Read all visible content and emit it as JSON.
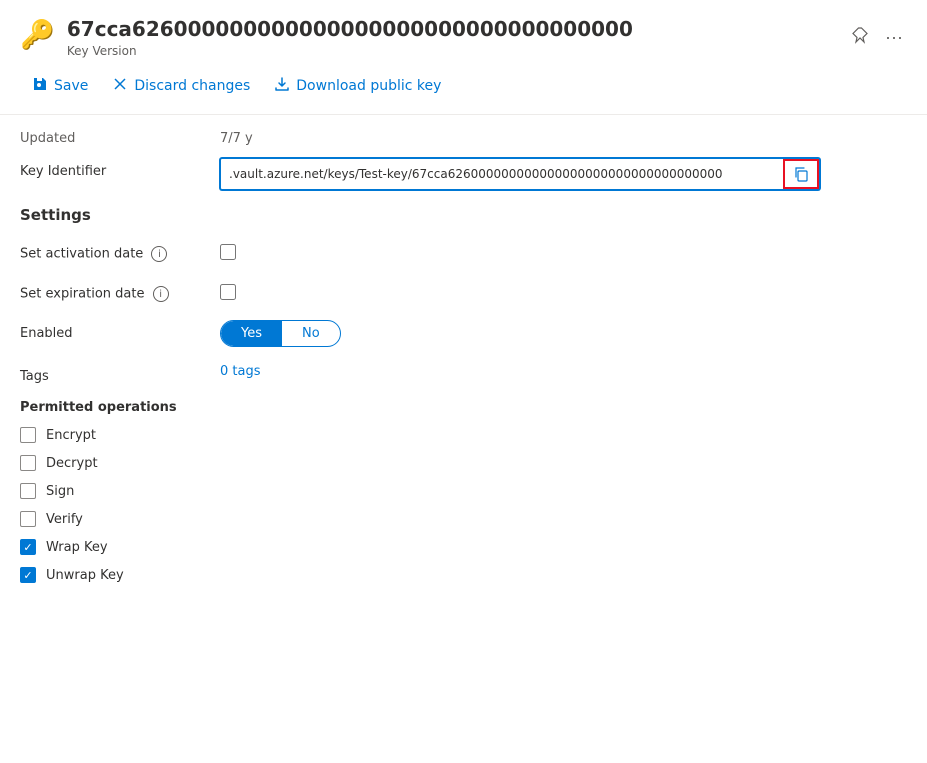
{
  "header": {
    "icon": "🔑",
    "title": "67cca626000000000000000000000000000000000",
    "subtitle": "Key Version",
    "pin_icon": "📌",
    "more_icon": "⋯"
  },
  "toolbar": {
    "save_label": "Save",
    "discard_label": "Discard changes",
    "download_label": "Download public key"
  },
  "updated_field": {
    "label": "Updated",
    "value": "7/7 y"
  },
  "key_identifier": {
    "label": "Key Identifier",
    "value": ".vault.azure.net/keys/Test-key/67cca626000000000000000000000000000000000",
    "copy_tooltip": "Copy to clipboard"
  },
  "settings": {
    "title": "Settings",
    "activation_date": {
      "label": "Set activation date",
      "checked": false
    },
    "expiration_date": {
      "label": "Set expiration date",
      "checked": false
    },
    "enabled": {
      "label": "Enabled",
      "yes_label": "Yes",
      "no_label": "No",
      "active": "yes"
    },
    "tags": {
      "label": "Tags",
      "value": "0 tags"
    }
  },
  "permitted_operations": {
    "title": "Permitted operations",
    "operations": [
      {
        "id": "encrypt",
        "label": "Encrypt",
        "checked": false
      },
      {
        "id": "decrypt",
        "label": "Decrypt",
        "checked": false
      },
      {
        "id": "sign",
        "label": "Sign",
        "checked": false
      },
      {
        "id": "verify",
        "label": "Verify",
        "checked": false
      },
      {
        "id": "wrap_key",
        "label": "Wrap Key",
        "checked": true
      },
      {
        "id": "unwrap_key",
        "label": "Unwrap Key",
        "checked": true
      }
    ]
  }
}
